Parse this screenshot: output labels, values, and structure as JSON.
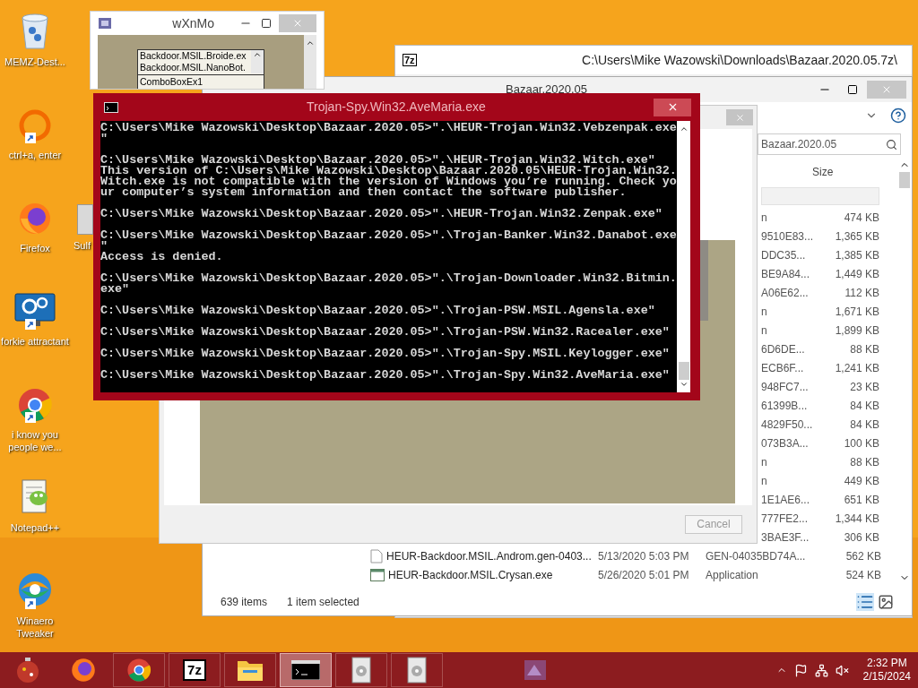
{
  "desktop_icons": [
    {
      "label": "MEMZ-Dest...",
      "kind": "bin",
      "shortcut": false
    },
    {
      "label": "ctrl+a, enter",
      "kind": "ring",
      "shortcut": true
    },
    {
      "label": "Firefox",
      "kind": "fox",
      "shortcut": false
    },
    {
      "label": "forkie attractant",
      "kind": "monitor",
      "shortcut": true
    },
    {
      "label": "i know you people we...",
      "kind": "chrome",
      "shortcut": true
    },
    {
      "label": "Notepad++",
      "kind": "notepad",
      "shortcut": false
    },
    {
      "label": "Winaero Tweaker",
      "kind": "swirl",
      "shortcut": true
    }
  ],
  "partial_icon": {
    "label": "Sulf"
  },
  "list_window": {
    "title": "wXnMo",
    "list_items": [
      "Backdoor.MSIL.Broide.ex",
      "Backdoor.MSIL.NanoBot."
    ],
    "combo": "ComboBoxEx1"
  },
  "archive_window": {
    "icon_text": "7z",
    "title": "C:\\Users\\Mike Wazowski\\Downloads\\Bazaar.2020.05.7z\\"
  },
  "explorer_window": {
    "title": "Bazaar.2020.05",
    "search": {
      "value": "Bazaar.2020.05"
    },
    "columns": [
      "Size"
    ],
    "rows": [
      {
        "type": "n",
        "size": "474 KB"
      },
      {
        "type": "9510E83...",
        "size": "1,365 KB"
      },
      {
        "type": "DDC35...",
        "size": "1,385 KB"
      },
      {
        "type": "BE9A84...",
        "size": "1,449 KB"
      },
      {
        "type": "A06E62...",
        "size": "112 KB"
      },
      {
        "type": "n",
        "size": "1,671 KB"
      },
      {
        "type": "n",
        "size": "1,899 KB"
      },
      {
        "type": "6D6DE...",
        "size": "88 KB"
      },
      {
        "type": "ECB6F...",
        "size": "1,241 KB"
      },
      {
        "type": "948FC7...",
        "size": "23 KB"
      },
      {
        "type": "61399B...",
        "size": "84 KB"
      },
      {
        "type": "4829F50...",
        "size": "84 KB"
      },
      {
        "type": "073B3A...",
        "size": "100 KB"
      },
      {
        "type": "n",
        "size": "88 KB"
      },
      {
        "type": "n",
        "size": "449 KB"
      },
      {
        "type": "1E1AE6...",
        "size": "651 KB"
      },
      {
        "type": "777FE2...",
        "size": "1,344 KB"
      },
      {
        "type": "3BAE3F...",
        "size": "306 KB"
      },
      {
        "kind": "file",
        "name": "HEUR-Backdoor.MSIL.Androm.gen-0403...",
        "date": "5/13/2020 5:03 PM",
        "type": "GEN-04035BD74A...",
        "size": "562 KB"
      },
      {
        "kind": "app",
        "name": "HEUR-Backdoor.MSIL.Crysan.exe",
        "date": "5/26/2020 5:01 PM",
        "type": "Application",
        "size": "524 KB"
      }
    ],
    "status_bar": {
      "count": "639 items",
      "selection": "1 item selected"
    }
  },
  "error_dialog": {
    "cancel_button": "Cancel"
  },
  "console_window": {
    "title": "Trojan-Spy.Win32.AveMaria.exe",
    "blocks": [
      [
        "C:\\Users\\Mike Wazowski\\Desktop\\Bazaar.2020.05>\".\\HEUR-Trojan.Win32.Vebzenpak.exe",
        "\""
      ],
      [
        "C:\\Users\\Mike Wazowski\\Desktop\\Bazaar.2020.05>\".\\HEUR-Trojan.Win32.Witch.exe\"",
        "This version of C:\\Users\\Mike Wazowski\\Desktop\\Bazaar.2020.05\\HEUR-Trojan.Win32.",
        "Witch.exe is not compatible with the version of Windows you’re running. Check yo",
        "ur computer’s system information and then contact the software publisher."
      ],
      [
        "C:\\Users\\Mike Wazowski\\Desktop\\Bazaar.2020.05>\".\\HEUR-Trojan.Win32.Zenpak.exe\""
      ],
      [
        "C:\\Users\\Mike Wazowski\\Desktop\\Bazaar.2020.05>\".\\Trojan-Banker.Win32.Danabot.exe",
        "\"",
        "Access is denied."
      ],
      [
        "C:\\Users\\Mike Wazowski\\Desktop\\Bazaar.2020.05>\".\\Trojan-Downloader.Win32.Bitmin.",
        "exe\""
      ],
      [
        "C:\\Users\\Mike Wazowski\\Desktop\\Bazaar.2020.05>\".\\Trojan-PSW.MSIL.Agensla.exe\""
      ],
      [
        "C:\\Users\\Mike Wazowski\\Desktop\\Bazaar.2020.05>\".\\Trojan-PSW.Win32.Racealer.exe\""
      ],
      [
        "C:\\Users\\Mike Wazowski\\Desktop\\Bazaar.2020.05>\".\\Trojan-Spy.MSIL.Keylogger.exe\""
      ],
      [
        "C:\\Users\\Mike Wazowski\\Desktop\\Bazaar.2020.05>\".\\Trojan-Spy.Win32.AveMaria.exe\""
      ]
    ]
  },
  "taskbar": {
    "items": [
      {
        "kind": "ornament",
        "selected": false
      },
      {
        "kind": "fox",
        "selected": false
      },
      {
        "kind": "chrome",
        "selected": false
      },
      {
        "kind": "archiver",
        "text": "7z",
        "selected": false
      },
      {
        "kind": "folder",
        "selected": false
      },
      {
        "kind": "console",
        "selected": true
      },
      {
        "kind": "installer",
        "selected": false
      },
      {
        "kind": "installer",
        "selected": false
      },
      {
        "kind": "faded",
        "selected": false
      }
    ],
    "time": "2:32 PM",
    "date": "2/15/2024"
  }
}
